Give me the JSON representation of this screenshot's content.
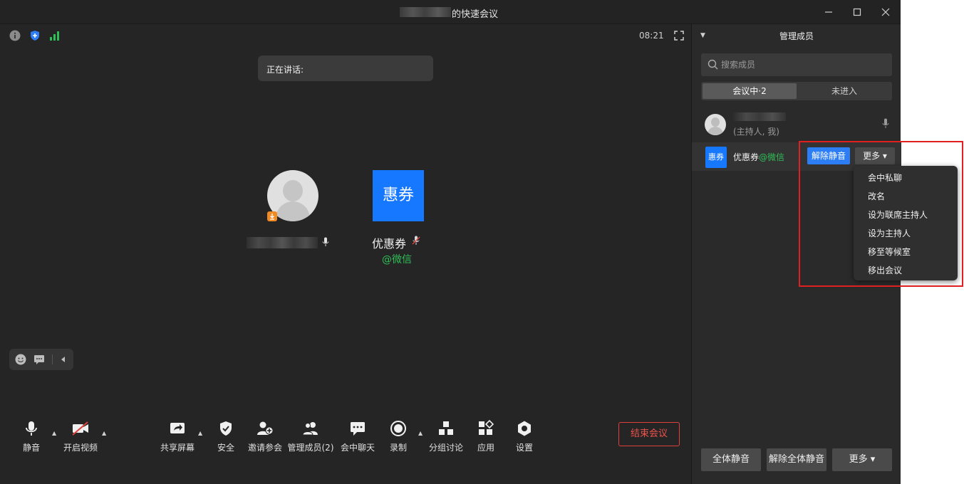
{
  "window": {
    "title": "的快速会议",
    "controls": [
      "minimize-icon",
      "maximize-icon",
      "close-icon"
    ]
  },
  "stage": {
    "status_icons": [
      "info-icon",
      "shield-icon",
      "signal-icon"
    ],
    "time": "08:21",
    "speaking_label": "正在讲话:",
    "participants": [
      {
        "kind": "avatar",
        "host_badge": true,
        "mic": "mic-icon"
      },
      {
        "kind": "logo",
        "logo_text": "惠券",
        "name": "优惠券",
        "wechat": "@微信",
        "mic": "mic-off-icon"
      }
    ]
  },
  "toolbar": {
    "items": [
      {
        "key": "mute",
        "label": "静音",
        "icon": "mic-icon"
      },
      {
        "key": "video",
        "label": "开启视频",
        "icon": "video-off-icon"
      },
      {
        "key": "share",
        "label": "共享屏幕",
        "icon": "share-screen-icon"
      },
      {
        "key": "security",
        "label": "安全",
        "icon": "shield-icon"
      },
      {
        "key": "invite",
        "label": "邀请参会",
        "icon": "add-user-icon"
      },
      {
        "key": "members",
        "label": "管理成员(2)",
        "icon": "users-icon"
      },
      {
        "key": "chat",
        "label": "会中聊天",
        "icon": "chat-icon"
      },
      {
        "key": "record",
        "label": "录制",
        "icon": "record-icon"
      },
      {
        "key": "breakout",
        "label": "分组讨论",
        "icon": "breakout-icon"
      },
      {
        "key": "apps",
        "label": "应用",
        "icon": "apps-icon"
      },
      {
        "key": "settings",
        "label": "设置",
        "icon": "settings-icon"
      }
    ],
    "end_meeting": "结束会议"
  },
  "panel": {
    "title": "管理成员",
    "search_placeholder": "搜索成员",
    "tabs": {
      "in_meeting": "会议中·2",
      "not_joined": "未进入"
    },
    "member1_role": "(主持人, 我)",
    "member2": {
      "logo_text": "惠券",
      "name": "优惠券",
      "wechat": "@微信"
    },
    "unmute": "解除静音",
    "more": "更多",
    "dropdown": [
      "会中私聊",
      "改名",
      "设为联席主持人",
      "设为主持人",
      "移至等候室",
      "移出会议"
    ],
    "footer": {
      "mute_all": "全体静音",
      "unmute_all": "解除全体静音",
      "more": "更多"
    }
  },
  "colors": {
    "accent_blue": "#2d7ef5",
    "logo_blue": "#1677ff",
    "wechat_green": "#2fbf57",
    "end_red": "#e0403c",
    "highlight_red": "#e02020"
  }
}
